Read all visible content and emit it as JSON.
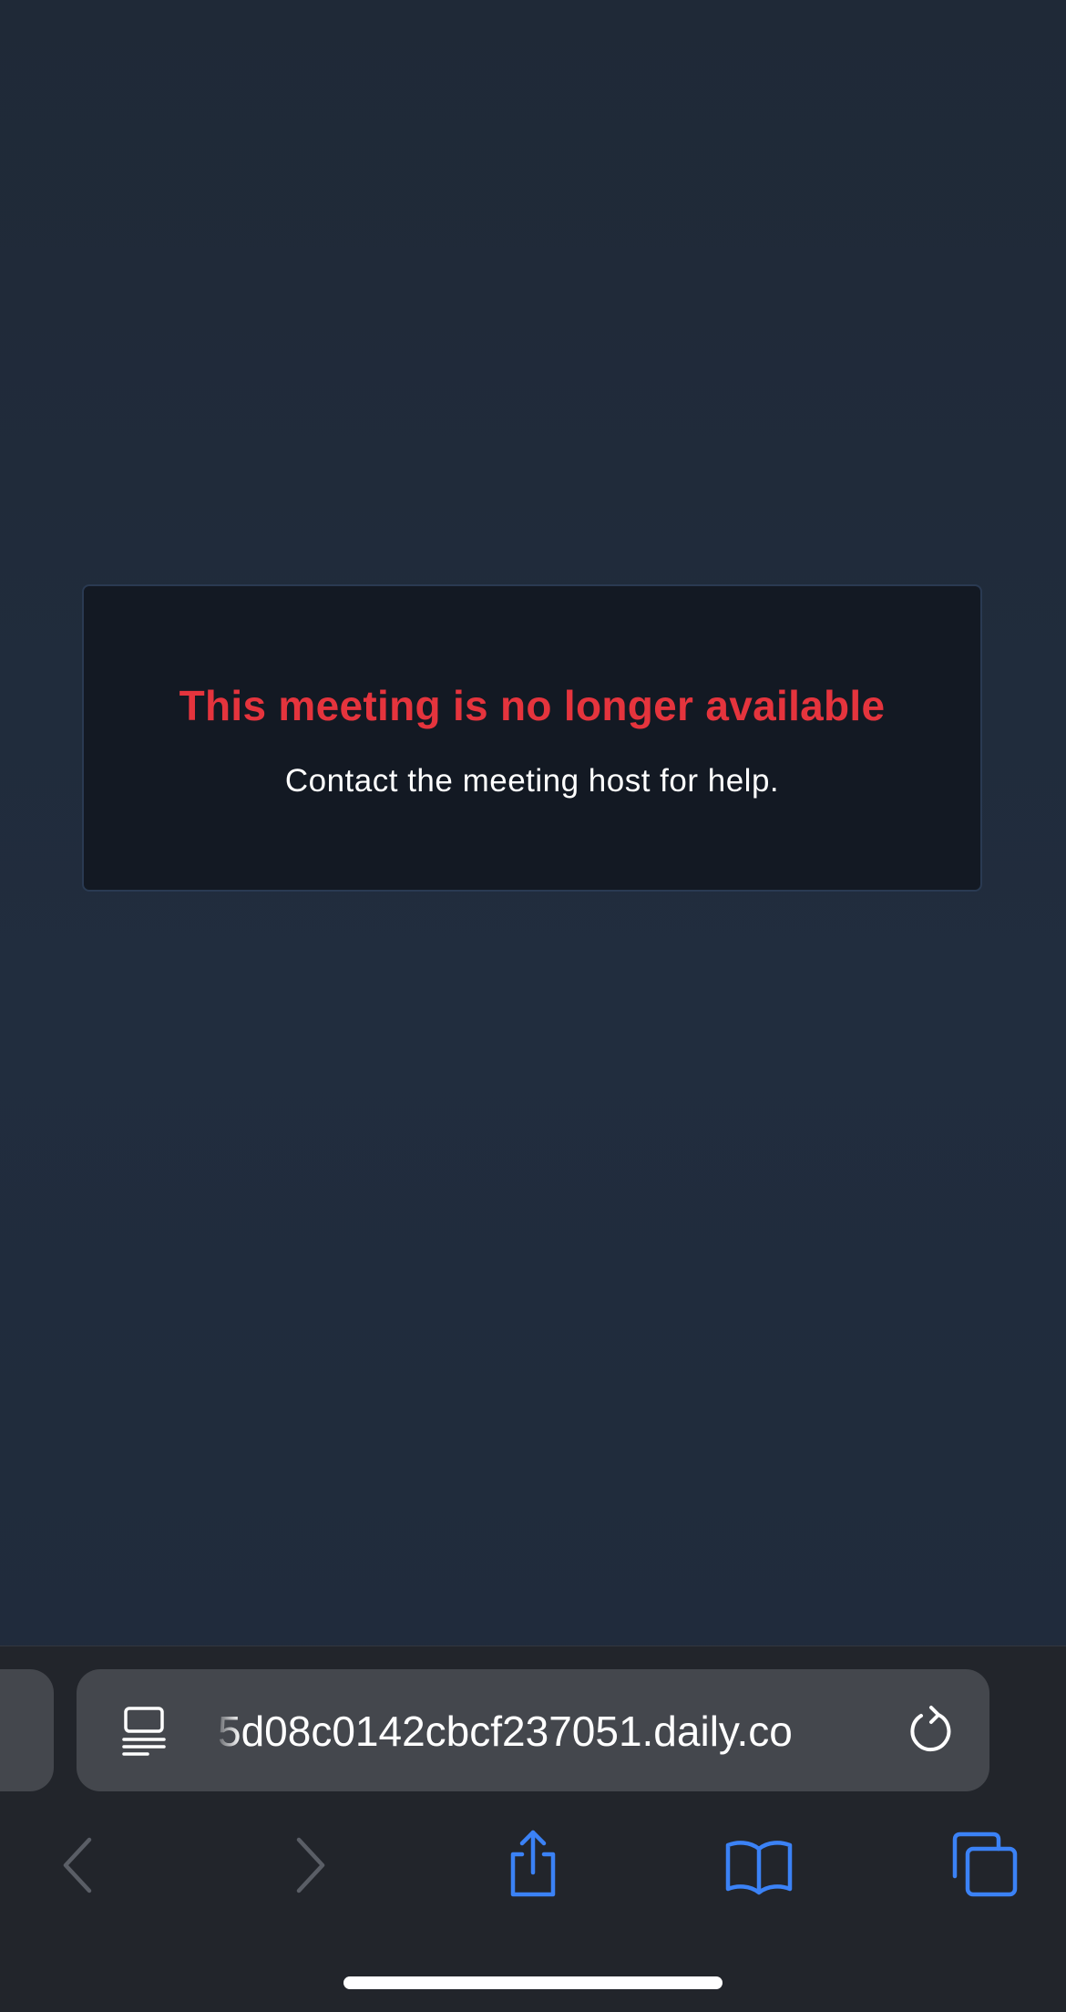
{
  "error": {
    "title": "This meeting is no longer available",
    "subtitle": "Contact the meeting host for help."
  },
  "browser": {
    "url": "5d08c0142cbcf237051.daily.co",
    "icons": {
      "reader": "reader-mode-icon",
      "reload": "reload-icon",
      "back": "chevron-left-icon",
      "forward": "chevron-right-icon",
      "share": "share-icon",
      "bookmarks": "book-icon",
      "tabs": "tabs-icon"
    }
  },
  "colors": {
    "page_background": "#202b3b",
    "card_background": "#131923",
    "error_title": "#e5343d",
    "browser_accent": "#3b82f6"
  }
}
